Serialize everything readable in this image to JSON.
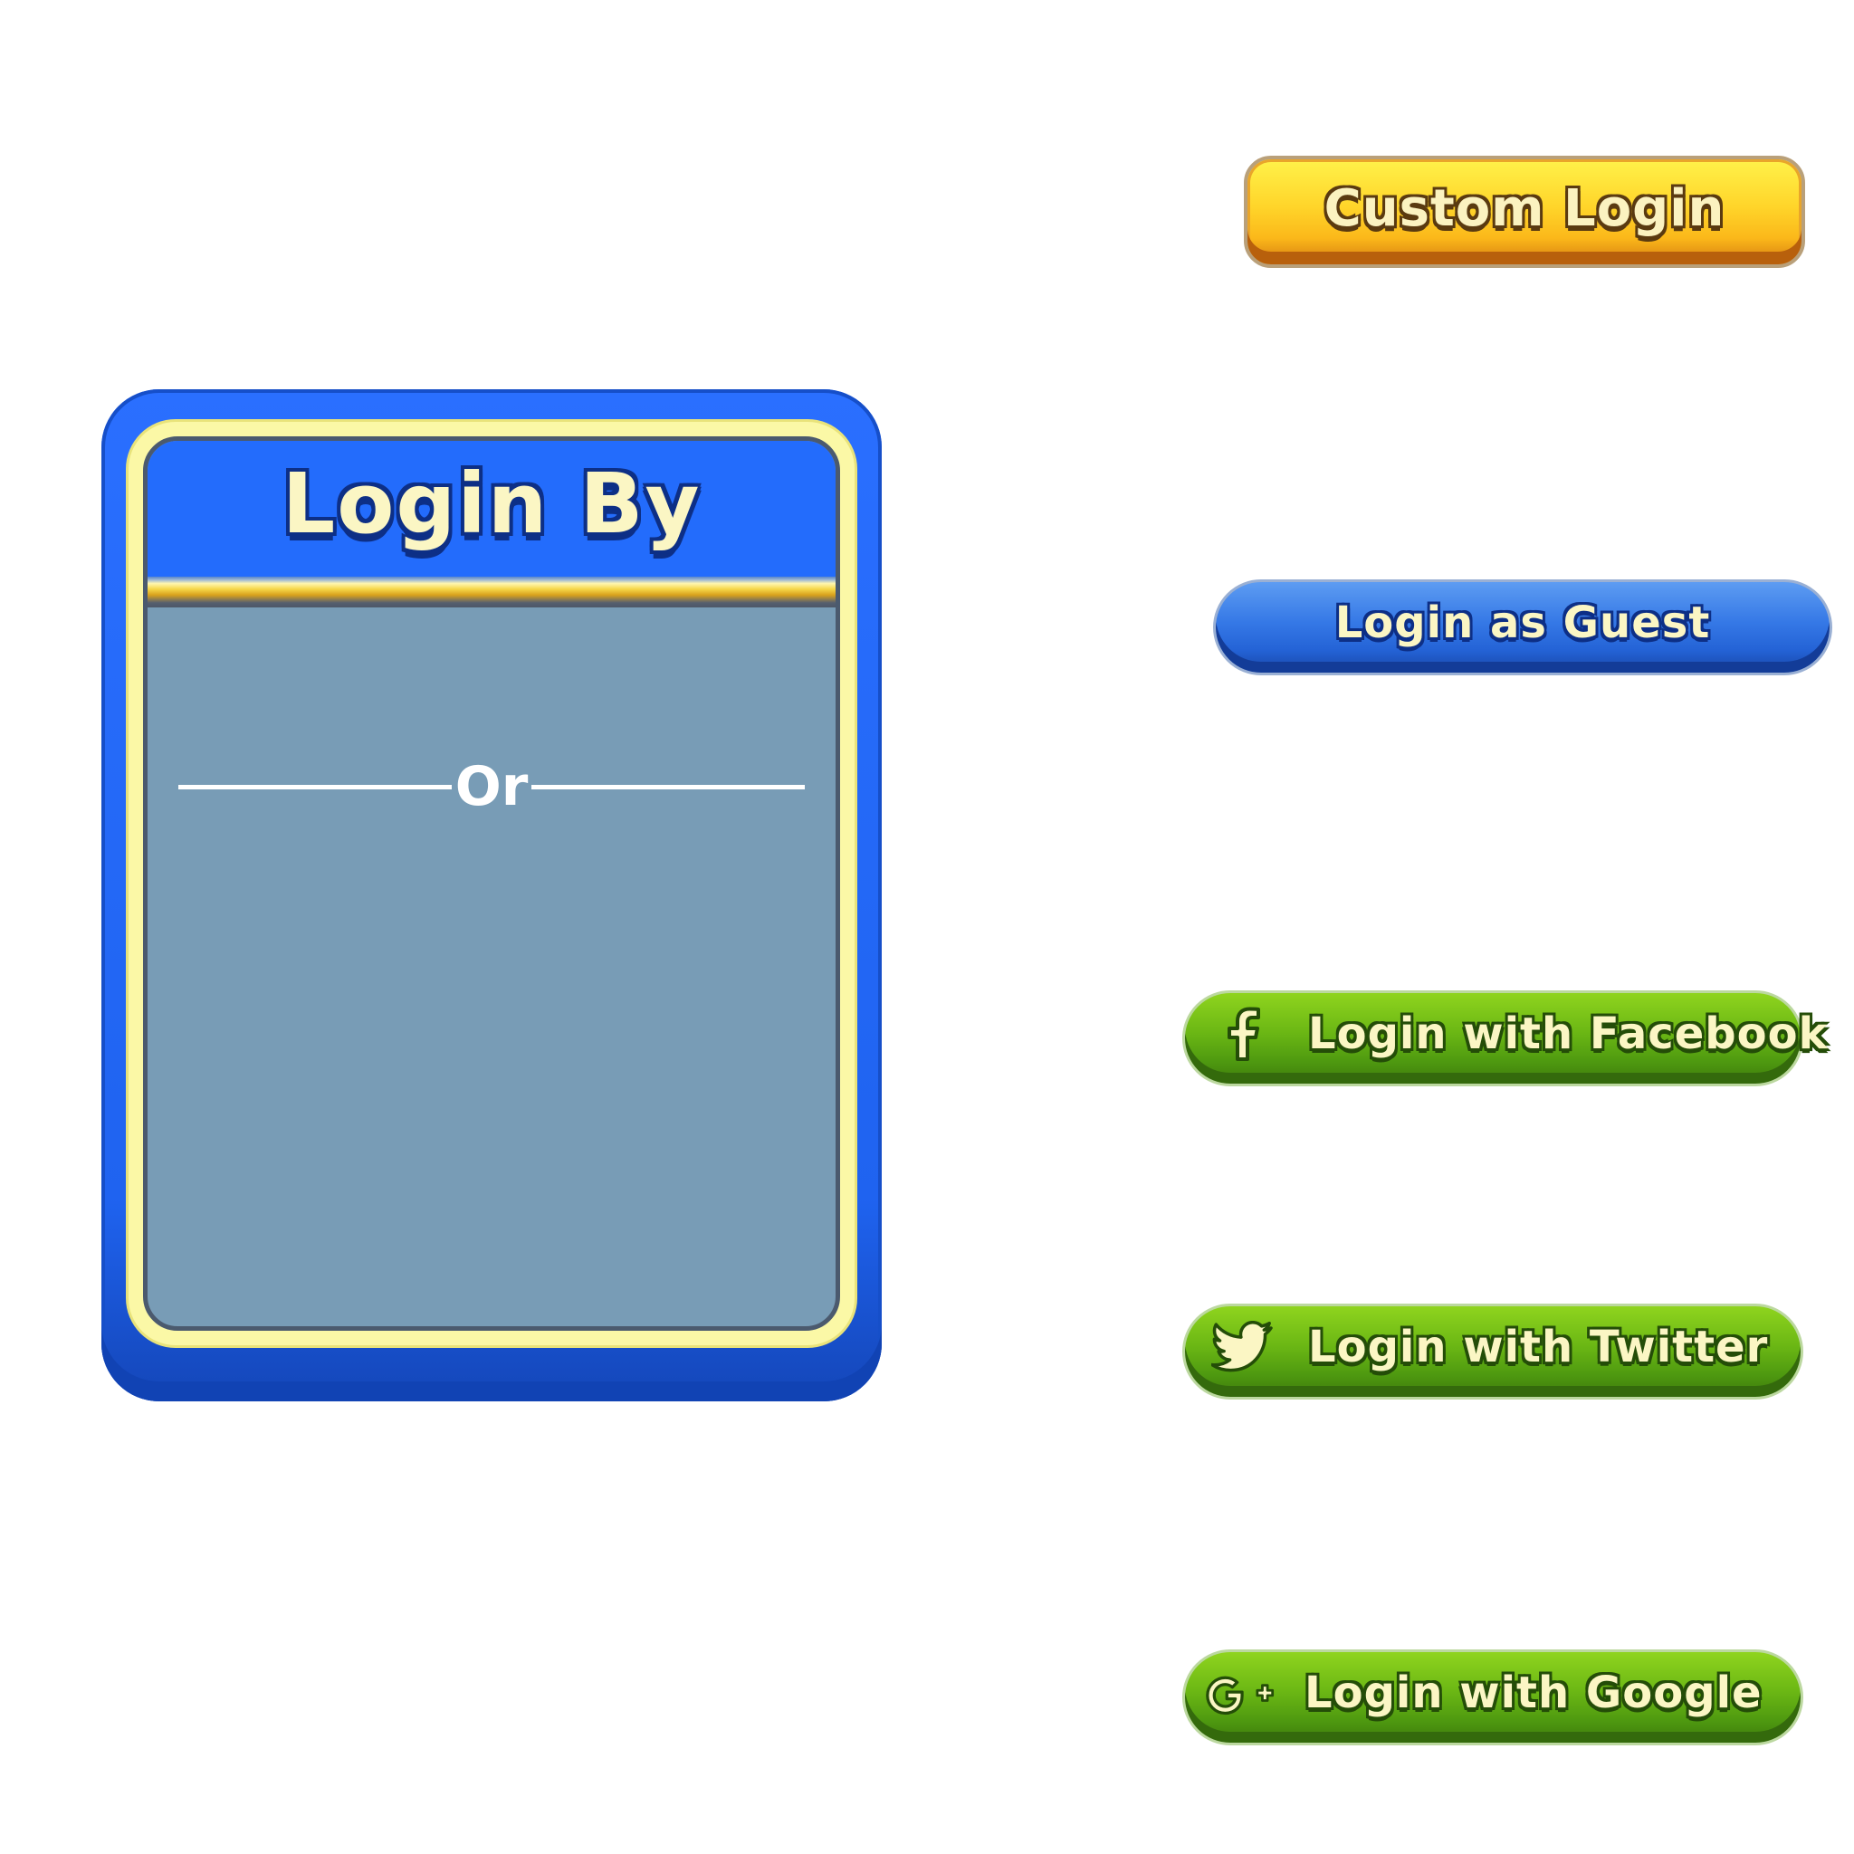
{
  "panel": {
    "title": "Login By",
    "divider_text": "Or"
  },
  "buttons": {
    "custom_login": {
      "label": "Custom Login"
    },
    "guest_login": {
      "label": "Login as Guest"
    },
    "facebook_login": {
      "label": "Login with Facebook",
      "icon": "facebook-icon"
    },
    "twitter_login": {
      "label": "Login with Twitter",
      "icon": "twitter-icon"
    },
    "google_login": {
      "label": "Login with Google",
      "icon": "google-plus-icon"
    }
  },
  "colors": {
    "panel_blue": "#236cfc",
    "panel_body": "#789cb6",
    "frame_yellow": "#fbf8a6",
    "custom_button": "#ffd52a",
    "guest_button": "#3578e6",
    "social_button": "#6ab614",
    "label_cream": "#fbf6c4"
  }
}
